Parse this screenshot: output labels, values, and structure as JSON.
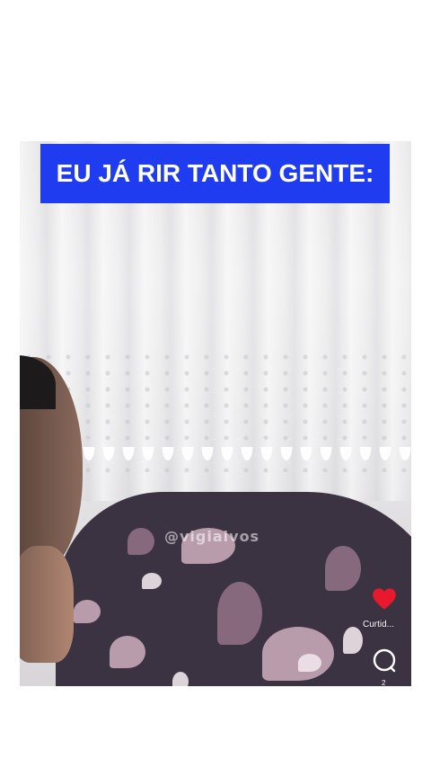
{
  "caption": {
    "text": "EU JÁ RIR TANTO GENTE:",
    "background_color": "#1f3cf0",
    "text_color": "#ffffff"
  },
  "watermark": {
    "text": "@vigiaivos"
  },
  "actions": {
    "like_icon": "heart-icon",
    "like_color": "#e8192c",
    "like_label": "Curtid...",
    "comment_icon": "comment-bubble-icon",
    "comment_count": "2"
  }
}
